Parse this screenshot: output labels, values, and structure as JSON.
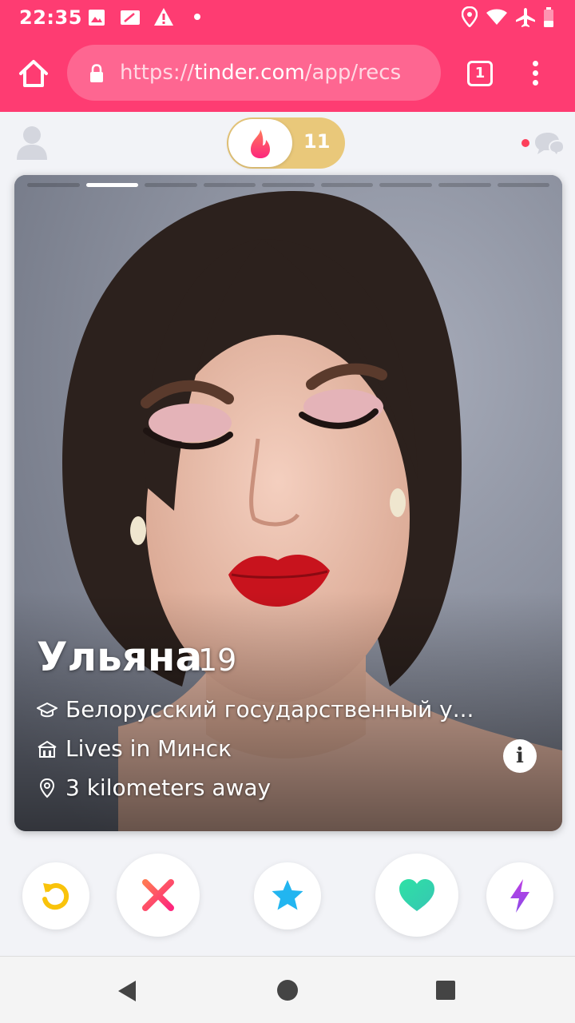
{
  "status_bar": {
    "time": "22:35"
  },
  "browser": {
    "url_prefix": "https://",
    "url_host": "tinder.com",
    "url_path": "/app/recs",
    "tab_count": "1"
  },
  "header": {
    "mode_count": "11"
  },
  "card": {
    "name": "Ульяна",
    "age": "19",
    "school": "Белорусский государственный у...",
    "lives": "Lives in Минск",
    "distance": "3 kilometers away",
    "photo_count": 9,
    "active_photo_index": 1,
    "info_label": "i"
  },
  "actions": [
    "rewind-icon",
    "nope-icon",
    "super-like-icon",
    "like-icon",
    "boost-icon"
  ],
  "colors": {
    "brand": "#fe3c72",
    "rewind": "#f9c30b",
    "nope": "#fd4f63",
    "super_like": "#22b5f0",
    "like": "#2ee1a5",
    "boost": "#a53fe5",
    "gold": "#e9c87a"
  }
}
